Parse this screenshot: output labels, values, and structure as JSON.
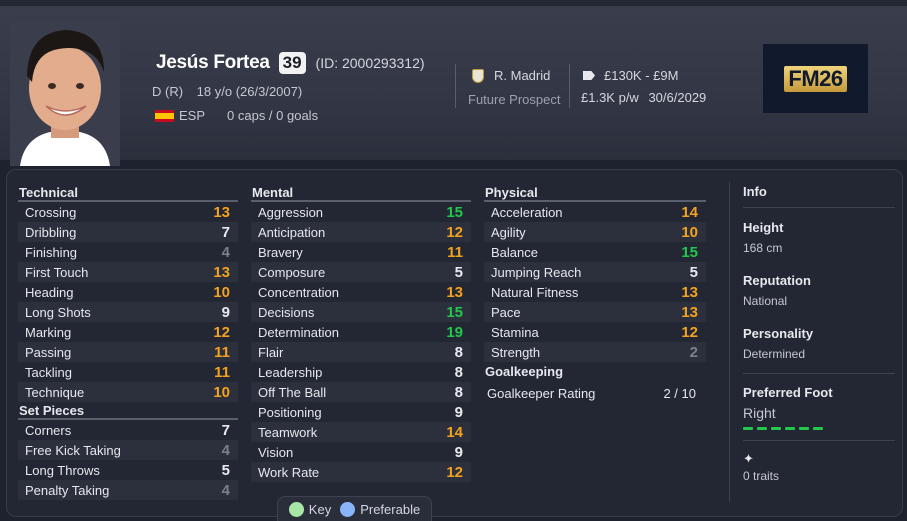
{
  "player": {
    "name": "Jesús Fortea",
    "ca": "39",
    "id_text": "(ID: 2000293312)",
    "position": "D (R)",
    "age_dob": "18 y/o (26/3/2007)",
    "nation": "ESP",
    "caps": "0 caps / 0 goals"
  },
  "club": {
    "name": "R. Madrid",
    "status": "Future Prospect"
  },
  "finance": {
    "value": "£130K - £9M",
    "wage": "£1.3K p/w",
    "contract_end": "30/6/2029"
  },
  "logo": {
    "text": "FM26"
  },
  "technical": {
    "title": "Technical",
    "rows": [
      {
        "label": "Crossing",
        "value": "13",
        "tier": "good"
      },
      {
        "label": "Dribbling",
        "value": "7",
        "tier": "mid"
      },
      {
        "label": "Finishing",
        "value": "4",
        "tier": "low"
      },
      {
        "label": "First Touch",
        "value": "13",
        "tier": "good"
      },
      {
        "label": "Heading",
        "value": "10",
        "tier": "good"
      },
      {
        "label": "Long Shots",
        "value": "9",
        "tier": "mid"
      },
      {
        "label": "Marking",
        "value": "12",
        "tier": "good"
      },
      {
        "label": "Passing",
        "value": "11",
        "tier": "good"
      },
      {
        "label": "Tackling",
        "value": "11",
        "tier": "good"
      },
      {
        "label": "Technique",
        "value": "10",
        "tier": "good"
      }
    ]
  },
  "set_pieces": {
    "title": "Set Pieces",
    "rows": [
      {
        "label": "Corners",
        "value": "7",
        "tier": "mid"
      },
      {
        "label": "Free Kick Taking",
        "value": "4",
        "tier": "low"
      },
      {
        "label": "Long Throws",
        "value": "5",
        "tier": "mid"
      },
      {
        "label": "Penalty Taking",
        "value": "4",
        "tier": "low"
      }
    ]
  },
  "mental": {
    "title": "Mental",
    "rows": [
      {
        "label": "Aggression",
        "value": "15",
        "tier": "high"
      },
      {
        "label": "Anticipation",
        "value": "12",
        "tier": "good"
      },
      {
        "label": "Bravery",
        "value": "11",
        "tier": "good"
      },
      {
        "label": "Composure",
        "value": "5",
        "tier": "mid"
      },
      {
        "label": "Concentration",
        "value": "13",
        "tier": "good"
      },
      {
        "label": "Decisions",
        "value": "15",
        "tier": "high"
      },
      {
        "label": "Determination",
        "value": "19",
        "tier": "high"
      },
      {
        "label": "Flair",
        "value": "8",
        "tier": "mid"
      },
      {
        "label": "Leadership",
        "value": "8",
        "tier": "mid"
      },
      {
        "label": "Off The Ball",
        "value": "8",
        "tier": "mid"
      },
      {
        "label": "Positioning",
        "value": "9",
        "tier": "mid"
      },
      {
        "label": "Teamwork",
        "value": "14",
        "tier": "good"
      },
      {
        "label": "Vision",
        "value": "9",
        "tier": "mid"
      },
      {
        "label": "Work Rate",
        "value": "12",
        "tier": "good"
      }
    ]
  },
  "physical": {
    "title": "Physical",
    "rows": [
      {
        "label": "Acceleration",
        "value": "14",
        "tier": "good"
      },
      {
        "label": "Agility",
        "value": "10",
        "tier": "good"
      },
      {
        "label": "Balance",
        "value": "15",
        "tier": "high"
      },
      {
        "label": "Jumping Reach",
        "value": "5",
        "tier": "mid"
      },
      {
        "label": "Natural Fitness",
        "value": "13",
        "tier": "good"
      },
      {
        "label": "Pace",
        "value": "13",
        "tier": "good"
      },
      {
        "label": "Stamina",
        "value": "12",
        "tier": "good"
      },
      {
        "label": "Strength",
        "value": "2",
        "tier": "low"
      }
    ]
  },
  "goalkeeping": {
    "title": "Goalkeeping",
    "label": "Goalkeeper Rating",
    "value": "2 / 10"
  },
  "info": {
    "title": "Info",
    "height_label": "Height",
    "height_value": "168 cm",
    "reputation_label": "Reputation",
    "reputation_value": "National",
    "personality_label": "Personality",
    "personality_value": "Determined",
    "foot_label": "Preferred Foot",
    "foot_value": "Right",
    "foot_level": 6,
    "traits_value": "0 traits"
  },
  "legend": {
    "key_label": "Key",
    "pref_label": "Preferable"
  },
  "colors": {
    "good": "#f2a21f",
    "high": "#22c84c",
    "mid": "#e8eaef",
    "low": "#7c808c"
  }
}
